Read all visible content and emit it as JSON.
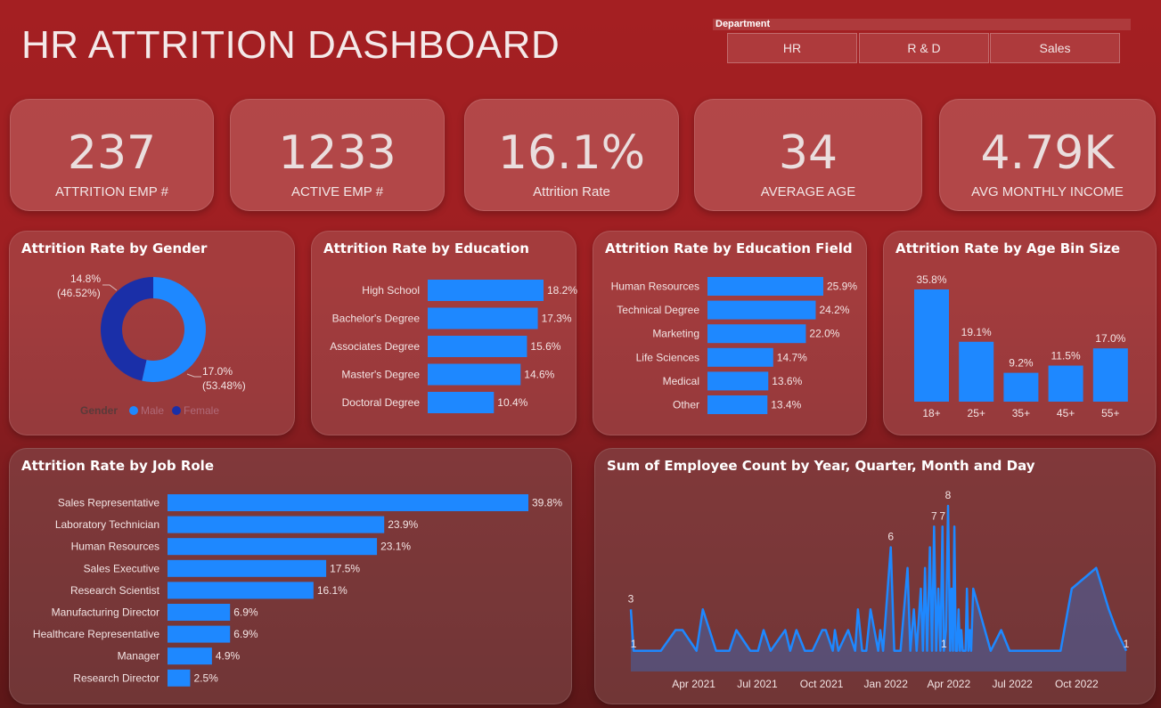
{
  "header": {
    "title": "HR ATTRITION DASHBOARD"
  },
  "slicer": {
    "label": "Department",
    "options": [
      "HR",
      "R & D",
      "Sales"
    ]
  },
  "kpis": [
    {
      "value": "237",
      "label": "ATTRITION EMP #"
    },
    {
      "value": "1233",
      "label": "ACTIVE EMP #"
    },
    {
      "value": "16.1%",
      "label": "Attrition Rate"
    },
    {
      "value": "34",
      "label": "AVERAGE AGE"
    },
    {
      "value": "4.79K",
      "label": "AVG MONTHLY INCOME"
    }
  ],
  "colors": {
    "bar": "#1e88ff",
    "donut_female": "#1a2fa8",
    "donut_male": "#1e88ff",
    "line": "#1e88ff"
  },
  "chart_data": [
    {
      "id": "gender",
      "type": "pie",
      "title": "Attrition Rate by Gender",
      "legend_title": "Gender",
      "legend_position": "bottom",
      "slices": [
        {
          "name": "Male",
          "value": 17.0,
          "label": "17.0%",
          "share": "(53.48%)"
        },
        {
          "name": "Female",
          "value": 14.8,
          "label": "14.8%",
          "share": "(46.52%)"
        }
      ]
    },
    {
      "id": "education",
      "type": "bar",
      "title": "Attrition Rate by Education",
      "orientation": "horizontal",
      "categories": [
        "High School",
        "Bachelor's Degree",
        "Associates Degree",
        "Master's Degree",
        "Doctoral Degree"
      ],
      "values": [
        18.2,
        17.3,
        15.6,
        14.6,
        10.4
      ],
      "value_labels": [
        "18.2%",
        "17.3%",
        "15.6%",
        "14.6%",
        "10.4%"
      ]
    },
    {
      "id": "edu_field",
      "type": "bar",
      "title": "Attrition Rate by Education Field",
      "orientation": "horizontal",
      "categories": [
        "Human Resources",
        "Technical Degree",
        "Marketing",
        "Life Sciences",
        "Medical",
        "Other"
      ],
      "values": [
        25.9,
        24.2,
        22.0,
        14.7,
        13.6,
        13.4
      ],
      "value_labels": [
        "25.9%",
        "24.2%",
        "22.0%",
        "14.7%",
        "13.6%",
        "13.4%"
      ]
    },
    {
      "id": "age_bin",
      "type": "bar",
      "title": "Attrition Rate by Age Bin Size",
      "orientation": "vertical",
      "categories": [
        "18+",
        "25+",
        "35+",
        "45+",
        "55+"
      ],
      "values": [
        35.8,
        19.1,
        9.2,
        11.5,
        17.0
      ],
      "value_labels": [
        "35.8%",
        "19.1%",
        "9.2%",
        "11.5%",
        "17.0%"
      ]
    },
    {
      "id": "job_role",
      "type": "bar",
      "title": "Attrition Rate by Job Role",
      "orientation": "horizontal",
      "categories": [
        "Sales Representative",
        "Laboratory Technician",
        "Human Resources",
        "Sales Executive",
        "Research Scientist",
        "Manufacturing Director",
        "Healthcare Representative",
        "Manager",
        "Research Director"
      ],
      "values": [
        39.8,
        23.9,
        23.1,
        17.5,
        16.1,
        6.9,
        6.9,
        4.9,
        2.5
      ],
      "value_labels": [
        "39.8%",
        "23.9%",
        "23.1%",
        "17.5%",
        "16.1%",
        "6.9%",
        "6.9%",
        "4.9%",
        "2.5%"
      ]
    },
    {
      "id": "emp_count",
      "type": "area",
      "title": "Sum of Employee Count by Year, Quarter, Month and Day",
      "x_ticks": [
        "Apr 2021",
        "Jul 2021",
        "Oct 2021",
        "Jan 2022",
        "Apr 2022",
        "Jul 2022",
        "Oct 2022"
      ],
      "ylim": [
        0,
        8
      ],
      "x": [
        "2021-01-01",
        "2021-01-05",
        "2021-02-09",
        "2021-02-13",
        "2021-03-06",
        "2021-03-16",
        "2021-04-05",
        "2021-04-14",
        "2021-05-03",
        "2021-05-08",
        "2021-05-22",
        "2021-06-01",
        "2021-06-21",
        "2021-07-02",
        "2021-07-10",
        "2021-07-20",
        "2021-08-10",
        "2021-08-17",
        "2021-08-26",
        "2021-09-07",
        "2021-09-18",
        "2021-10-02",
        "2021-10-07",
        "2021-10-17",
        "2021-10-20",
        "2021-10-25",
        "2021-11-08",
        "2021-11-18",
        "2021-11-22",
        "2021-11-28",
        "2021-12-04",
        "2021-12-10",
        "2021-12-21",
        "2021-12-24",
        "2021-12-28",
        "2022-01-08",
        "2022-01-13",
        "2022-01-22",
        "2022-02-01",
        "2022-02-05",
        "2022-02-10",
        "2022-02-14",
        "2022-02-20",
        "2022-02-23",
        "2022-02-26",
        "2022-03-01",
        "2022-03-05",
        "2022-03-08",
        "2022-03-11",
        "2022-03-14",
        "2022-03-17",
        "2022-03-20",
        "2022-03-23",
        "2022-03-25",
        "2022-03-28",
        "2022-03-31",
        "2022-04-03",
        "2022-04-05",
        "2022-04-07",
        "2022-04-09",
        "2022-04-11",
        "2022-04-13",
        "2022-04-15",
        "2022-04-17",
        "2022-04-19",
        "2022-04-21",
        "2022-04-23",
        "2022-04-25",
        "2022-04-27",
        "2022-04-29",
        "2022-05-01",
        "2022-05-03",
        "2022-05-06",
        "2022-05-31",
        "2022-06-15",
        "2022-06-27",
        "2022-07-10",
        "2022-08-24",
        "2022-09-08",
        "2022-09-24",
        "2022-10-29",
        "2022-11-16",
        "2022-11-27",
        "2022-12-11"
      ],
      "y": [
        3,
        1,
        1,
        1,
        2,
        2,
        1,
        3,
        1,
        1,
        1,
        2,
        1,
        1,
        2,
        1,
        2,
        1,
        2,
        1,
        1,
        2,
        2,
        1,
        2,
        1,
        2,
        1,
        3,
        1,
        1,
        3,
        1,
        2,
        1,
        6,
        1,
        1,
        5,
        1,
        3,
        1,
        4,
        1,
        5,
        1,
        6,
        1,
        7,
        1,
        4,
        1,
        7,
        1,
        2,
        8,
        1,
        4,
        1,
        7,
        1,
        1,
        3,
        1,
        2,
        1,
        1,
        1,
        4,
        1,
        2,
        1,
        4,
        1,
        2,
        1,
        1,
        1,
        1,
        4,
        5,
        3,
        2,
        1
      ],
      "point_labels": [
        {
          "x": "2021-01-01",
          "y": 3,
          "label": "3"
        },
        {
          "x": "2021-01-05",
          "y": 1,
          "label": "1"
        },
        {
          "x": "2022-01-08",
          "y": 6,
          "label": "6"
        },
        {
          "x": "2022-03-11",
          "y": 7,
          "label": "7"
        },
        {
          "x": "2022-03-23",
          "y": 7,
          "label": "7"
        },
        {
          "x": "2022-03-31",
          "y": 8,
          "label": "8"
        },
        {
          "x": "2022-03-25",
          "y": 1,
          "label": "1"
        },
        {
          "x": "2022-12-11",
          "y": 1,
          "label": "1"
        }
      ]
    }
  ]
}
